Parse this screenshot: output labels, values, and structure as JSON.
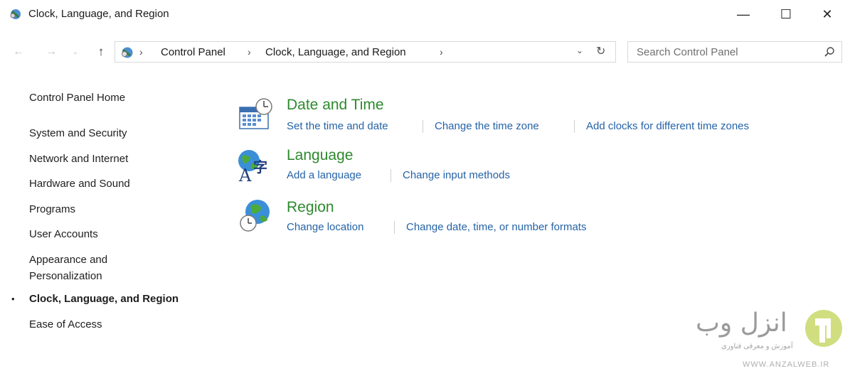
{
  "window": {
    "title": "Clock, Language, and Region",
    "minimize_glyph": "—",
    "maximize_glyph": "☐",
    "close_glyph": "✕"
  },
  "nav": {
    "back_glyph": "←",
    "forward_glyph": "→",
    "history_glyph": "⌄",
    "up_glyph": "↑",
    "breadcrumbs": [
      "Control Panel",
      "Clock, Language, and Region"
    ],
    "separator": "›",
    "dropdown_glyph": "⌄",
    "refresh_glyph": "↻"
  },
  "search": {
    "placeholder": "Search Control Panel"
  },
  "sidebar": {
    "items": [
      {
        "label": "Control Panel Home"
      },
      {
        "label": "System and Security"
      },
      {
        "label": "Network and Internet"
      },
      {
        "label": "Hardware and Sound"
      },
      {
        "label": "Programs"
      },
      {
        "label": "User Accounts"
      },
      {
        "label": "Appearance and"
      },
      {
        "label": "Personalization"
      },
      {
        "label": "Clock, Language, and Region",
        "active": true
      },
      {
        "label": "Ease of Access"
      }
    ],
    "bullet": "•"
  },
  "categories": [
    {
      "title": "Date and Time",
      "icon": "calendar-clock-icon",
      "links": [
        "Set the time and date",
        "Change the time zone",
        "Add clocks for different time zones"
      ]
    },
    {
      "title": "Language",
      "icon": "language-globe-icon",
      "links": [
        "Add a language",
        "Change input methods"
      ]
    },
    {
      "title": "Region",
      "icon": "region-globe-clock-icon",
      "links": [
        "Change location",
        "Change date, time, or number formats"
      ]
    }
  ],
  "watermark": {
    "brand": "انزل وب",
    "tagline": "آموزش و معرفی فناوری",
    "url": "WWW.ANZALWEB.IR"
  },
  "colors": {
    "category_title": "#2d8a2d",
    "link": "#2563a6",
    "text": "#1e1e1e"
  }
}
